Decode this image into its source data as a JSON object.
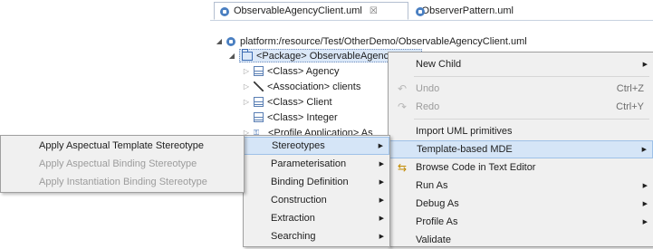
{
  "tabs": [
    {
      "label": "ObservableAgencyClient.uml",
      "close": "☒"
    },
    {
      "label": "ObserverPattern.uml"
    }
  ],
  "tree": {
    "root": "platform:/resource/Test/OtherDemo/ObservableAgencyClient.uml",
    "package": "<Package> ObservableAgencyClient",
    "children": [
      "<Class> Agency",
      "<Association> clients",
      "<Class> Client",
      "<Class> Integer",
      "<Profile Application> As"
    ]
  },
  "context_menu": {
    "items": [
      {
        "label": "New Child",
        "submenu": true
      },
      {
        "label": "Undo",
        "accel": "Ctrl+Z",
        "disabled": true,
        "icon": "undo-icon"
      },
      {
        "label": "Redo",
        "accel": "Ctrl+Y",
        "disabled": true,
        "icon": "redo-icon"
      },
      {
        "label": "Import UML primitives"
      },
      {
        "label": "Template-based MDE",
        "submenu": true,
        "highlighted": true
      },
      {
        "label": "Browse Code in Text Editor",
        "icon": "browse-code-icon"
      },
      {
        "label": "Run As",
        "submenu": true
      },
      {
        "label": "Debug As",
        "submenu": true
      },
      {
        "label": "Profile As",
        "submenu": true
      },
      {
        "label": "Validate"
      }
    ]
  },
  "submenu": {
    "items": [
      {
        "label": "Stereotypes",
        "highlighted": true
      },
      {
        "label": "Parameterisation"
      },
      {
        "label": "Binding Definition"
      },
      {
        "label": "Construction"
      },
      {
        "label": "Extraction"
      },
      {
        "label": "Searching"
      }
    ]
  },
  "stereotypes_menu": {
    "items": [
      {
        "label": "Apply Aspectual Template Stereotype",
        "disabled": false
      },
      {
        "label": "Apply Aspectual Binding Stereotype",
        "disabled": true
      },
      {
        "label": "Apply Instantiation Binding Stereotype",
        "disabled": true
      }
    ]
  },
  "colors": {
    "highlight": "#d5e5f7",
    "menu_bg": "#f0f0f0",
    "disabled_text": "#9c9c9c",
    "icon_blue": "#4a7fc1"
  }
}
